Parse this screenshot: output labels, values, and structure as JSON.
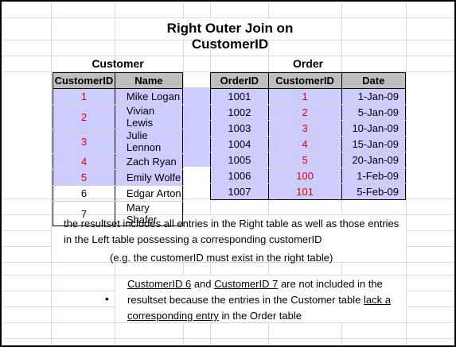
{
  "title": "Right Outer Join on CustomerID",
  "customer_table": {
    "title": "Customer",
    "headers": [
      "CustomerID",
      "Name"
    ],
    "rows": [
      {
        "id": "1",
        "name": "Mike Logan"
      },
      {
        "id": "2",
        "name": "Vivian Lewis"
      },
      {
        "id": "3",
        "name": "Julie Lennon"
      },
      {
        "id": "4",
        "name": "Zach Ryan"
      },
      {
        "id": "5",
        "name": "Emily Wolfe"
      },
      {
        "id": "6",
        "name": "Edgar Arton"
      },
      {
        "id": "7",
        "name": "Mary Shafer"
      }
    ]
  },
  "order_table": {
    "title": "Order",
    "headers": [
      "OrderID",
      "CustomerID",
      "Date"
    ],
    "rows": [
      {
        "order_id": "1001",
        "customer_id": "1",
        "date": "1-Jan-09"
      },
      {
        "order_id": "1002",
        "customer_id": "2",
        "date": "5-Jan-09"
      },
      {
        "order_id": "1003",
        "customer_id": "3",
        "date": "10-Jan-09"
      },
      {
        "order_id": "1004",
        "customer_id": "4",
        "date": "15-Jan-09"
      },
      {
        "order_id": "1005",
        "customer_id": "5",
        "date": "20-Jan-09"
      },
      {
        "order_id": "1006",
        "customer_id": "100",
        "date": "1-Feb-09"
      },
      {
        "order_id": "1007",
        "customer_id": "101",
        "date": "5-Feb-09"
      }
    ]
  },
  "explanation": "the resultset includes all entries in the Right table as well as those entries in the Left table possessing a corresponding customerID",
  "example": "(e.g. the customerID must exist in the right table)",
  "bullet": {
    "symbol": "•",
    "id6": "CustomerID 6",
    "and": " and ",
    "id7": "CustomerID 7",
    "mid": " are not included in the resultset because the entries in the Customer table ",
    "lack": "lack a corresponding entry",
    "end": " in the Order table"
  },
  "colors": {
    "highlight": "#ccccff",
    "header": "#bfbfbf",
    "red_id": "#e00000"
  }
}
